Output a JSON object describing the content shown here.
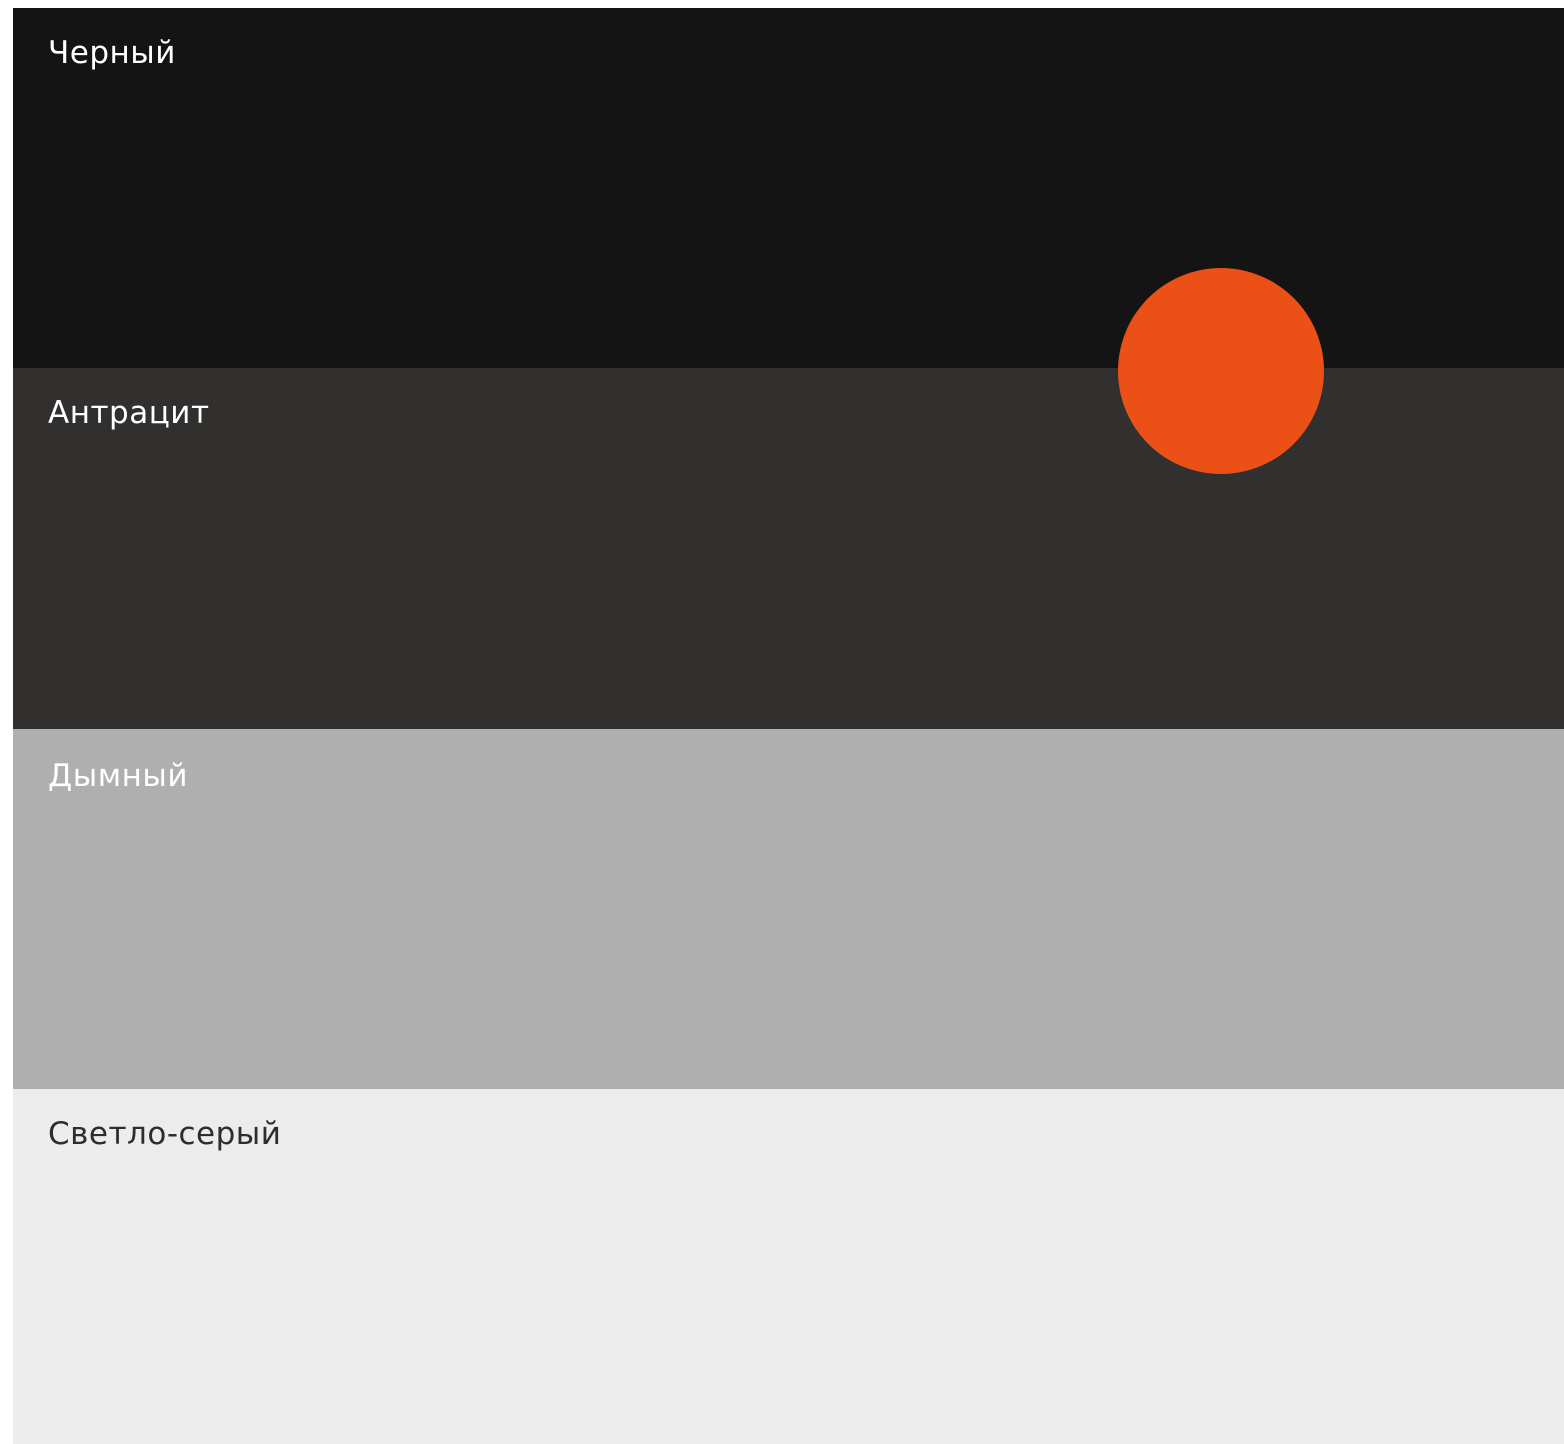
{
  "swatches": [
    {
      "label": "Черный",
      "color": "#141414",
      "text_color": "#ffffff"
    },
    {
      "label": "Антрацит",
      "color": "#31302f",
      "text_color": "#ffffff"
    },
    {
      "label": "Дымный",
      "color": "#afafaf",
      "text_color": "#ffffff"
    },
    {
      "label": "Светло-серый",
      "color": "#ececec",
      "text_color": "#2e2d2c"
    }
  ],
  "accent": {
    "color": "#eb5016"
  }
}
